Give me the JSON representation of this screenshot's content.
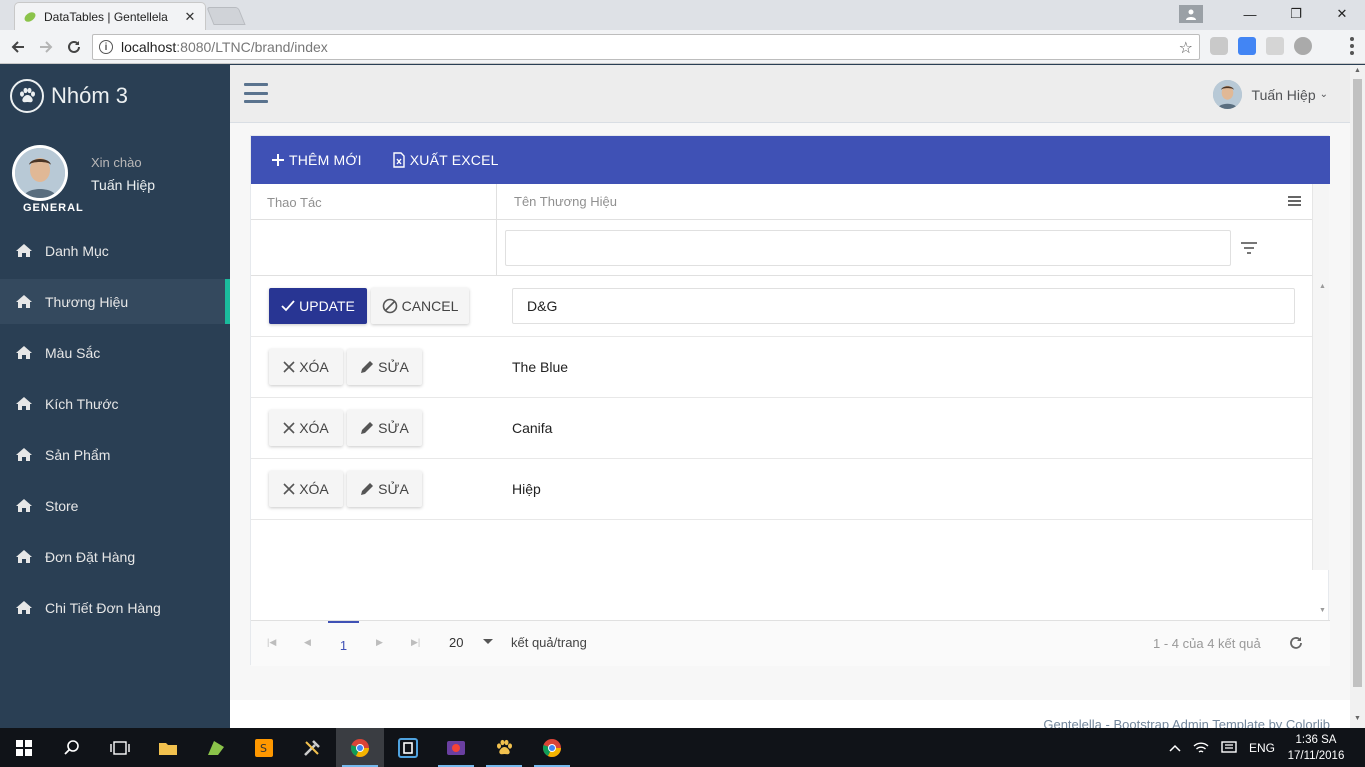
{
  "browser": {
    "tab_title": "DataTables | Gentellela",
    "url_host": "localhost",
    "url_path": ":8080/LTNC/brand/index"
  },
  "app": {
    "brand": "Nhóm 3",
    "greeting": "Xin chào",
    "user_name": "Tuấn Hiệp",
    "section": "GENERAL",
    "menu": [
      {
        "label": "Danh Mục",
        "icon": "home-icon",
        "active": false
      },
      {
        "label": "Thương Hiệu",
        "icon": "home-icon",
        "active": true
      },
      {
        "label": "Màu Sắc",
        "icon": "home-icon",
        "active": false
      },
      {
        "label": "Kích Thước",
        "icon": "home-icon",
        "active": false
      },
      {
        "label": "Sản Phẩm",
        "icon": "home-icon",
        "active": false
      },
      {
        "label": "Store",
        "icon": "home-icon",
        "active": false
      },
      {
        "label": "Đơn Đặt Hàng",
        "icon": "home-icon",
        "active": false
      },
      {
        "label": "Chi Tiết Đơn Hàng",
        "icon": "home-icon",
        "active": false
      }
    ]
  },
  "topnav": {
    "user_name": "Tuấn Hiệp"
  },
  "grid": {
    "toolbar": {
      "add_label": "THÊM MỚI",
      "export_label": "XUẤT EXCEL"
    },
    "columns": [
      "Thao Tác",
      "Tên Thương Hiệu"
    ],
    "filter_value": "",
    "edit_row": {
      "value": "D&G",
      "update_label": "UPDATE",
      "cancel_label": "CANCEL"
    },
    "rows": [
      {
        "name": "The Blue"
      },
      {
        "name": "Canifa"
      },
      {
        "name": "Hiệp"
      }
    ],
    "delete_label": "XÓA",
    "edit_label": "SỬA",
    "pager": {
      "current_page": "1",
      "page_size": "20",
      "page_size_label": "kết quả/trang",
      "info": "1 - 4 của 4 kết quả"
    }
  },
  "footer": {
    "text": "Gentelella - Bootstrap Admin Template by Colorlib"
  },
  "taskbar": {
    "language": "ENG",
    "time": "1:36 SA",
    "date": "17/11/2016"
  },
  "colors": {
    "sidebar_bg": "#2a3f54",
    "sidebar_active_accent": "#1abb9c",
    "grid_toolbar": "#3f51b5",
    "update_button": "#283593"
  }
}
